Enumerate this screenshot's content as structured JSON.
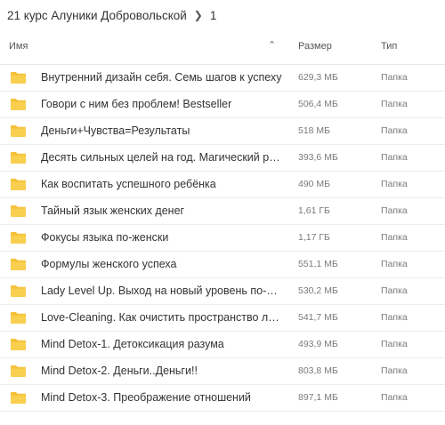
{
  "breadcrumb": {
    "parent": "21 курс Алуники Добровольской",
    "current": "1"
  },
  "columns": {
    "name": "Имя",
    "size": "Размер",
    "type": "Тип"
  },
  "icons": {
    "folder": "folder-icon",
    "sort": "chevron-up-icon",
    "separator": "chevron-right-icon",
    "folder_color": "#f5c138"
  },
  "rows": [
    {
      "name": "Внутренний дизайн себя. Семь шагов к успеху",
      "size": "629,3 МБ",
      "type": "Папка"
    },
    {
      "name": "Говори с ним без проблем! Bestseller",
      "size": "506,4 МБ",
      "type": "Папка"
    },
    {
      "name": "Деньги+Чувства=Результаты",
      "size": "518 МБ",
      "type": "Папка"
    },
    {
      "name": "Десять сильных целей на год. Магический ритуал",
      "size": "393,6 МБ",
      "type": "Папка"
    },
    {
      "name": "Как воспитать успешного ребёнка",
      "size": "490 МБ",
      "type": "Папка"
    },
    {
      "name": "Тайный язык женских денег",
      "size": "1,61 ГБ",
      "type": "Папка"
    },
    {
      "name": "Фокусы языка по-женски",
      "size": "1,17 ГБ",
      "type": "Папка"
    },
    {
      "name": "Формулы женского успеха",
      "size": "551,1 МБ",
      "type": "Папка"
    },
    {
      "name": "Lady Level Up. Выход на новый уровень по-женски",
      "size": "530,2 МБ",
      "type": "Папка"
    },
    {
      "name": "Love-Cleaning. Как очистить пространство любви",
      "size": "541,7 МБ",
      "type": "Папка"
    },
    {
      "name": "Mind Detox-1. Детоксикация разума",
      "size": "493,9 МБ",
      "type": "Папка"
    },
    {
      "name": "Mind Detox-2. Деньги..Деньги!!",
      "size": "803,8 МБ",
      "type": "Папка"
    },
    {
      "name": "Mind Detox-3. Преображение отношений",
      "size": "897,1 МБ",
      "type": "Папка"
    }
  ]
}
